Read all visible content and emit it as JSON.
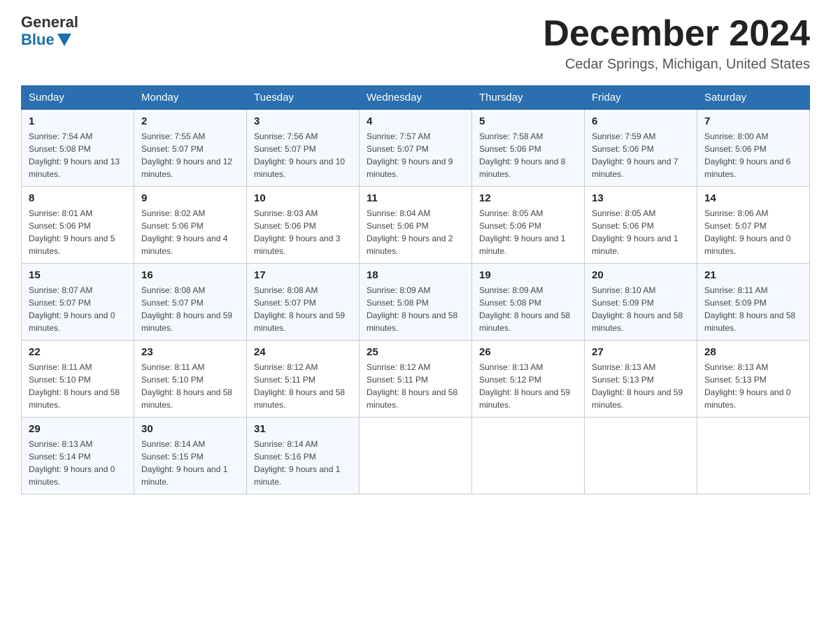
{
  "header": {
    "logo_general": "General",
    "logo_blue": "Blue",
    "month_title": "December 2024",
    "location": "Cedar Springs, Michigan, United States"
  },
  "days_of_week": [
    "Sunday",
    "Monday",
    "Tuesday",
    "Wednesday",
    "Thursday",
    "Friday",
    "Saturday"
  ],
  "weeks": [
    [
      {
        "day": "1",
        "sunrise": "7:54 AM",
        "sunset": "5:08 PM",
        "daylight": "9 hours and 13 minutes."
      },
      {
        "day": "2",
        "sunrise": "7:55 AM",
        "sunset": "5:07 PM",
        "daylight": "9 hours and 12 minutes."
      },
      {
        "day": "3",
        "sunrise": "7:56 AM",
        "sunset": "5:07 PM",
        "daylight": "9 hours and 10 minutes."
      },
      {
        "day": "4",
        "sunrise": "7:57 AM",
        "sunset": "5:07 PM",
        "daylight": "9 hours and 9 minutes."
      },
      {
        "day": "5",
        "sunrise": "7:58 AM",
        "sunset": "5:06 PM",
        "daylight": "9 hours and 8 minutes."
      },
      {
        "day": "6",
        "sunrise": "7:59 AM",
        "sunset": "5:06 PM",
        "daylight": "9 hours and 7 minutes."
      },
      {
        "day": "7",
        "sunrise": "8:00 AM",
        "sunset": "5:06 PM",
        "daylight": "9 hours and 6 minutes."
      }
    ],
    [
      {
        "day": "8",
        "sunrise": "8:01 AM",
        "sunset": "5:06 PM",
        "daylight": "9 hours and 5 minutes."
      },
      {
        "day": "9",
        "sunrise": "8:02 AM",
        "sunset": "5:06 PM",
        "daylight": "9 hours and 4 minutes."
      },
      {
        "day": "10",
        "sunrise": "8:03 AM",
        "sunset": "5:06 PM",
        "daylight": "9 hours and 3 minutes."
      },
      {
        "day": "11",
        "sunrise": "8:04 AM",
        "sunset": "5:06 PM",
        "daylight": "9 hours and 2 minutes."
      },
      {
        "day": "12",
        "sunrise": "8:05 AM",
        "sunset": "5:06 PM",
        "daylight": "9 hours and 1 minute."
      },
      {
        "day": "13",
        "sunrise": "8:05 AM",
        "sunset": "5:06 PM",
        "daylight": "9 hours and 1 minute."
      },
      {
        "day": "14",
        "sunrise": "8:06 AM",
        "sunset": "5:07 PM",
        "daylight": "9 hours and 0 minutes."
      }
    ],
    [
      {
        "day": "15",
        "sunrise": "8:07 AM",
        "sunset": "5:07 PM",
        "daylight": "9 hours and 0 minutes."
      },
      {
        "day": "16",
        "sunrise": "8:08 AM",
        "sunset": "5:07 PM",
        "daylight": "8 hours and 59 minutes."
      },
      {
        "day": "17",
        "sunrise": "8:08 AM",
        "sunset": "5:07 PM",
        "daylight": "8 hours and 59 minutes."
      },
      {
        "day": "18",
        "sunrise": "8:09 AM",
        "sunset": "5:08 PM",
        "daylight": "8 hours and 58 minutes."
      },
      {
        "day": "19",
        "sunrise": "8:09 AM",
        "sunset": "5:08 PM",
        "daylight": "8 hours and 58 minutes."
      },
      {
        "day": "20",
        "sunrise": "8:10 AM",
        "sunset": "5:09 PM",
        "daylight": "8 hours and 58 minutes."
      },
      {
        "day": "21",
        "sunrise": "8:11 AM",
        "sunset": "5:09 PM",
        "daylight": "8 hours and 58 minutes."
      }
    ],
    [
      {
        "day": "22",
        "sunrise": "8:11 AM",
        "sunset": "5:10 PM",
        "daylight": "8 hours and 58 minutes."
      },
      {
        "day": "23",
        "sunrise": "8:11 AM",
        "sunset": "5:10 PM",
        "daylight": "8 hours and 58 minutes."
      },
      {
        "day": "24",
        "sunrise": "8:12 AM",
        "sunset": "5:11 PM",
        "daylight": "8 hours and 58 minutes."
      },
      {
        "day": "25",
        "sunrise": "8:12 AM",
        "sunset": "5:11 PM",
        "daylight": "8 hours and 58 minutes."
      },
      {
        "day": "26",
        "sunrise": "8:13 AM",
        "sunset": "5:12 PM",
        "daylight": "8 hours and 59 minutes."
      },
      {
        "day": "27",
        "sunrise": "8:13 AM",
        "sunset": "5:13 PM",
        "daylight": "8 hours and 59 minutes."
      },
      {
        "day": "28",
        "sunrise": "8:13 AM",
        "sunset": "5:13 PM",
        "daylight": "9 hours and 0 minutes."
      }
    ],
    [
      {
        "day": "29",
        "sunrise": "8:13 AM",
        "sunset": "5:14 PM",
        "daylight": "9 hours and 0 minutes."
      },
      {
        "day": "30",
        "sunrise": "8:14 AM",
        "sunset": "5:15 PM",
        "daylight": "9 hours and 1 minute."
      },
      {
        "day": "31",
        "sunrise": "8:14 AM",
        "sunset": "5:16 PM",
        "daylight": "9 hours and 1 minute."
      },
      null,
      null,
      null,
      null
    ]
  ]
}
